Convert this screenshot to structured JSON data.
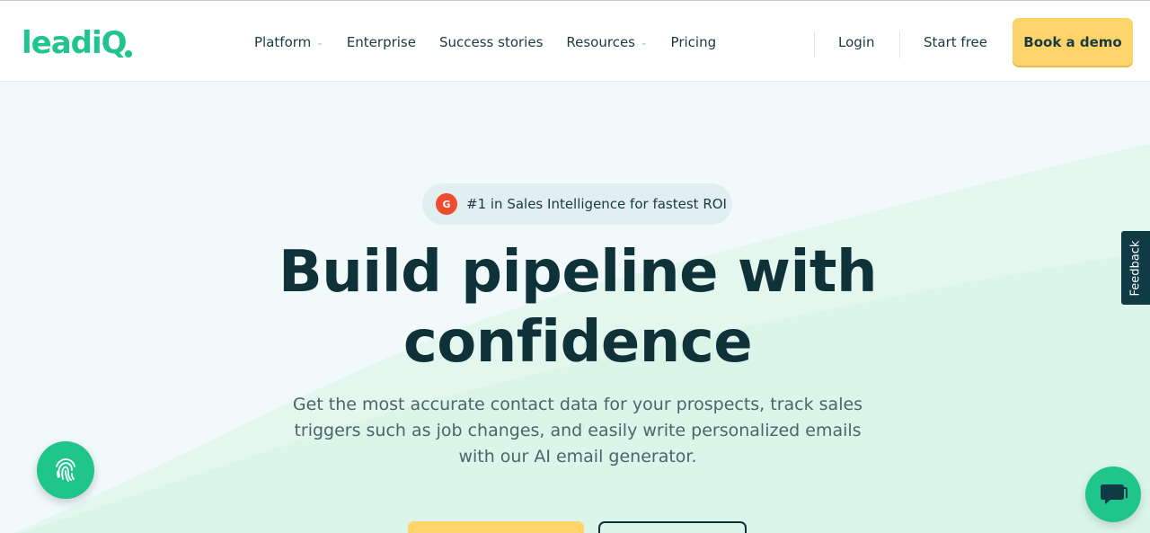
{
  "brand": {
    "logo_text": "leadiQ",
    "accent_color": "#1fc58a",
    "cta_color": "#fcd46a",
    "text_color": "#0f3238"
  },
  "nav": {
    "items": [
      {
        "label": "Platform",
        "has_dropdown": true
      },
      {
        "label": "Enterprise",
        "has_dropdown": false
      },
      {
        "label": "Success stories",
        "has_dropdown": false
      },
      {
        "label": "Resources",
        "has_dropdown": true
      },
      {
        "label": "Pricing",
        "has_dropdown": false
      }
    ],
    "login": "Login",
    "start_free": "Start free",
    "book_demo": "Book a demo",
    "dropdown_icon": "chevron-down-icon"
  },
  "hero": {
    "badge_icon_text": "G",
    "badge_text": "#1 in Sales Intelligence for fastest ROI",
    "headline_line1": "Build pipeline with",
    "headline_line2": "confidence",
    "subhead_line1": "Get the most accurate contact data for your prospects, track sales",
    "subhead_line2": "triggers such as job changes, and easily write personalized emails",
    "subhead_line3": "with our AI email generator."
  },
  "widgets": {
    "feedback_label": "Feedback",
    "fingerprint_icon": "fingerprint-icon",
    "chat_icon": "chat-bubble-icon"
  }
}
